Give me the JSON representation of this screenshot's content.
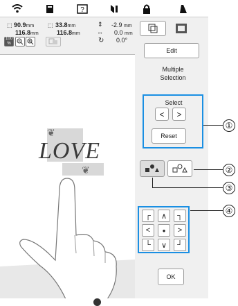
{
  "topbar": {
    "icons": [
      "wifi-icon",
      "book-icon",
      "help-icon",
      "thread-icon",
      "lock-icon",
      "presser-foot-icon"
    ]
  },
  "info": {
    "w1": "90.9",
    "w1_unit": "mm",
    "h1": "116.8",
    "h1_unit": "mm",
    "w2": "33.8",
    "w2_unit": "mm",
    "h2": "116.8",
    "h2_unit": "mm",
    "vy": "-2.9",
    "vy_unit": "mm",
    "vx": "0.0",
    "vx_unit": "mm",
    "rot": "0.0°",
    "zoom": "100 %"
  },
  "canvas": {
    "design_text": "LOVE"
  },
  "panel": {
    "edit_label": "Edit",
    "title": "Multiple\nSelection",
    "select_label": "Select",
    "prev_label": "<",
    "next_label": ">",
    "reset_label": "Reset",
    "ok_label": "OK",
    "arrows": [
      "┌",
      "∧",
      "┐",
      "<",
      "●",
      ">",
      "└",
      "∨",
      "┘"
    ]
  },
  "callouts": [
    "①",
    "②",
    "③",
    "④"
  ]
}
